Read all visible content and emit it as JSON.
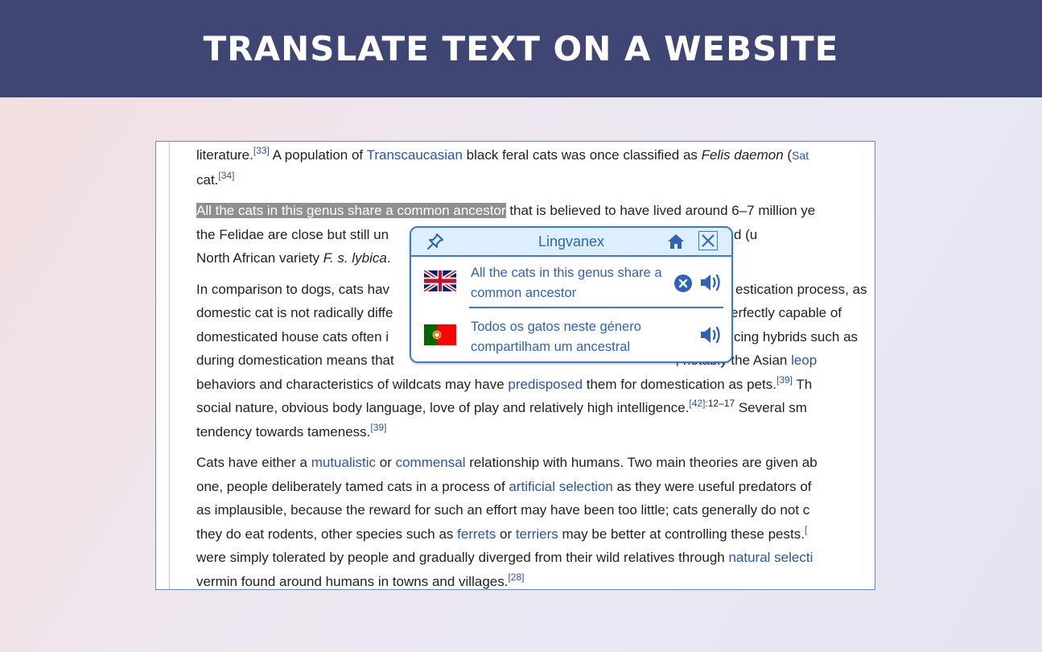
{
  "banner": {
    "title": "TRANSLATE TEXT ON A WEBSITE"
  },
  "article": {
    "p1": {
      "l1_a": "literature.",
      "l1_ref": "[33]",
      "l1_b": " A population of ",
      "l1_link": "Transcaucasian",
      "l1_c": " black feral cats was once classified as ",
      "l1_italic": "Felis daemon",
      "l1_d": " (",
      "l1_link2": "Sat",
      "l2_a": "cat.",
      "l2_ref": "[34]"
    },
    "p2": {
      "l1_highlight": "All the cats in this genus share a common ancestor",
      "l1_rest": " that is believed to have lived around 6–7 million ye",
      "l2_a": "the Felidae are close but still un",
      "l2_b": "ometimes classified (u",
      "l3_a": "North African variety ",
      "l3_italic": "F. s. lybica",
      "l3_b": "."
    },
    "p3": {
      "l1_a": "In comparison to dogs, cats hav",
      "l1_b": "estication process, as",
      "l2_a": "domestic cat is not radically diffe",
      "l2_b": "e perfectly capable of",
      "l3_a": "domesticated house cats often i",
      "l3_b": "ducing hybrids such as",
      "l4_a": "during domestication means that ",
      "l4_b": ", notably the Asian ",
      "l4_link": "leop",
      "l5_a": "behaviors and characteristics of wildcats may have ",
      "l5_link": "predisposed",
      "l5_b": " them for domestication as pets.",
      "l5_ref": "[39]",
      "l5_c": " Th",
      "l6_a": "social nature, obvious body language, love of play and relatively high intelligence.",
      "l6_ref": "[42]",
      "l6_pages": ":12–17",
      "l6_b": " Several sm",
      "l7_a": "tendency towards tameness.",
      "l7_ref": "[39]"
    },
    "p4": {
      "l1_a": "Cats have either a ",
      "l1_link1": "mutualistic",
      "l1_b": " or ",
      "l1_link2": "commensal",
      "l1_c": " relationship with humans. Two main theories are given ab",
      "l2_a": "one, people deliberately tamed cats in a process of ",
      "l2_link": "artificial selection",
      "l2_b": " as they were useful predators of",
      "l3_a": "as implausible, because the reward for such an effort may have been too little; cats generally do not c",
      "l4_a": "they do eat rodents, other species such as ",
      "l4_link1": "ferrets",
      "l4_b": " or ",
      "l4_link2": "terriers",
      "l4_c": " may be better at controlling these pests.",
      "l4_ref": "[",
      "l5_a": "were simply tolerated by people and gradually diverged from their wild relatives through ",
      "l5_link": "natural selecti",
      "l6_a": "vermin found around humans in towns and villages.",
      "l6_ref": "[28]"
    }
  },
  "popup": {
    "title": "Lingvanex",
    "source_text": "All the cats in this genus share a common ancestor",
    "target_text": "Todos os gatos neste género compartilham um ancestral",
    "icons": {
      "pin": "pin-icon",
      "home": "home-icon",
      "close": "close-icon",
      "clear": "clear-icon",
      "speaker": "speaker-icon",
      "source_flag": "uk-flag-icon",
      "target_flag": "portugal-flag-icon"
    }
  },
  "colors": {
    "banner": "#3f4674",
    "link": "#2b55a3",
    "popup_accent": "#3b7cc9",
    "popup_header": "#ddeefc",
    "highlight": "#8f8f8f"
  }
}
